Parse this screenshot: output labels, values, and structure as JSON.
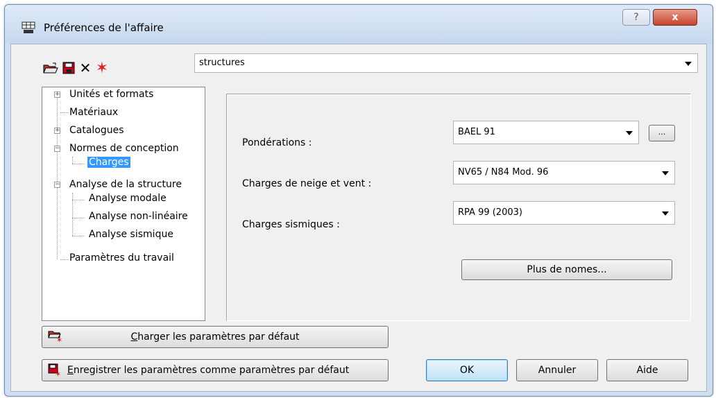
{
  "window": {
    "title": "Préférences de l'affaire",
    "help_label": "?",
    "close_label": "x"
  },
  "toolbar": {
    "icons": [
      "open-folder-icon",
      "save-icon",
      "delete-icon",
      "new-star-icon"
    ],
    "delete_glyph": "✕",
    "star_glyph": "✶"
  },
  "config_select": {
    "value": "structures"
  },
  "tree": {
    "items": [
      {
        "label": "Unités et formats",
        "expander": "+"
      },
      {
        "label": "Matériaux",
        "expander": ""
      },
      {
        "label": "Catalogues",
        "expander": "+"
      },
      {
        "label": "Normes de conception",
        "expander": "−"
      },
      {
        "label": "Charges",
        "expander": "",
        "selected": true
      },
      {
        "label": "Analyse de la structure",
        "expander": "−"
      },
      {
        "label": "Analyse modale",
        "expander": ""
      },
      {
        "label": "Analyse non-linéaire",
        "expander": ""
      },
      {
        "label": "Analyse sismique",
        "expander": ""
      },
      {
        "label": "Paramètres du travail",
        "expander": ""
      }
    ]
  },
  "form": {
    "ponderations": {
      "label": "Pondérations :",
      "value": "BAEL 91",
      "ellipsis": "..."
    },
    "neige_vent": {
      "label": "Charges de neige et vent :",
      "value": "NV65 / N84 Mod. 96"
    },
    "sismiques": {
      "label": "Charges sismiques :",
      "value": "RPA 99 (2003)"
    },
    "more_button": "Plus de nomes..."
  },
  "buttons": {
    "load_defaults_prefix": "C",
    "load_defaults_rest": "harger les paramètres par défaut",
    "save_defaults_prefix": "E",
    "save_defaults_rest": "nregistrer les paramètres comme paramètres par défaut",
    "ok": "OK",
    "cancel": "Annuler",
    "help": "Aide"
  }
}
